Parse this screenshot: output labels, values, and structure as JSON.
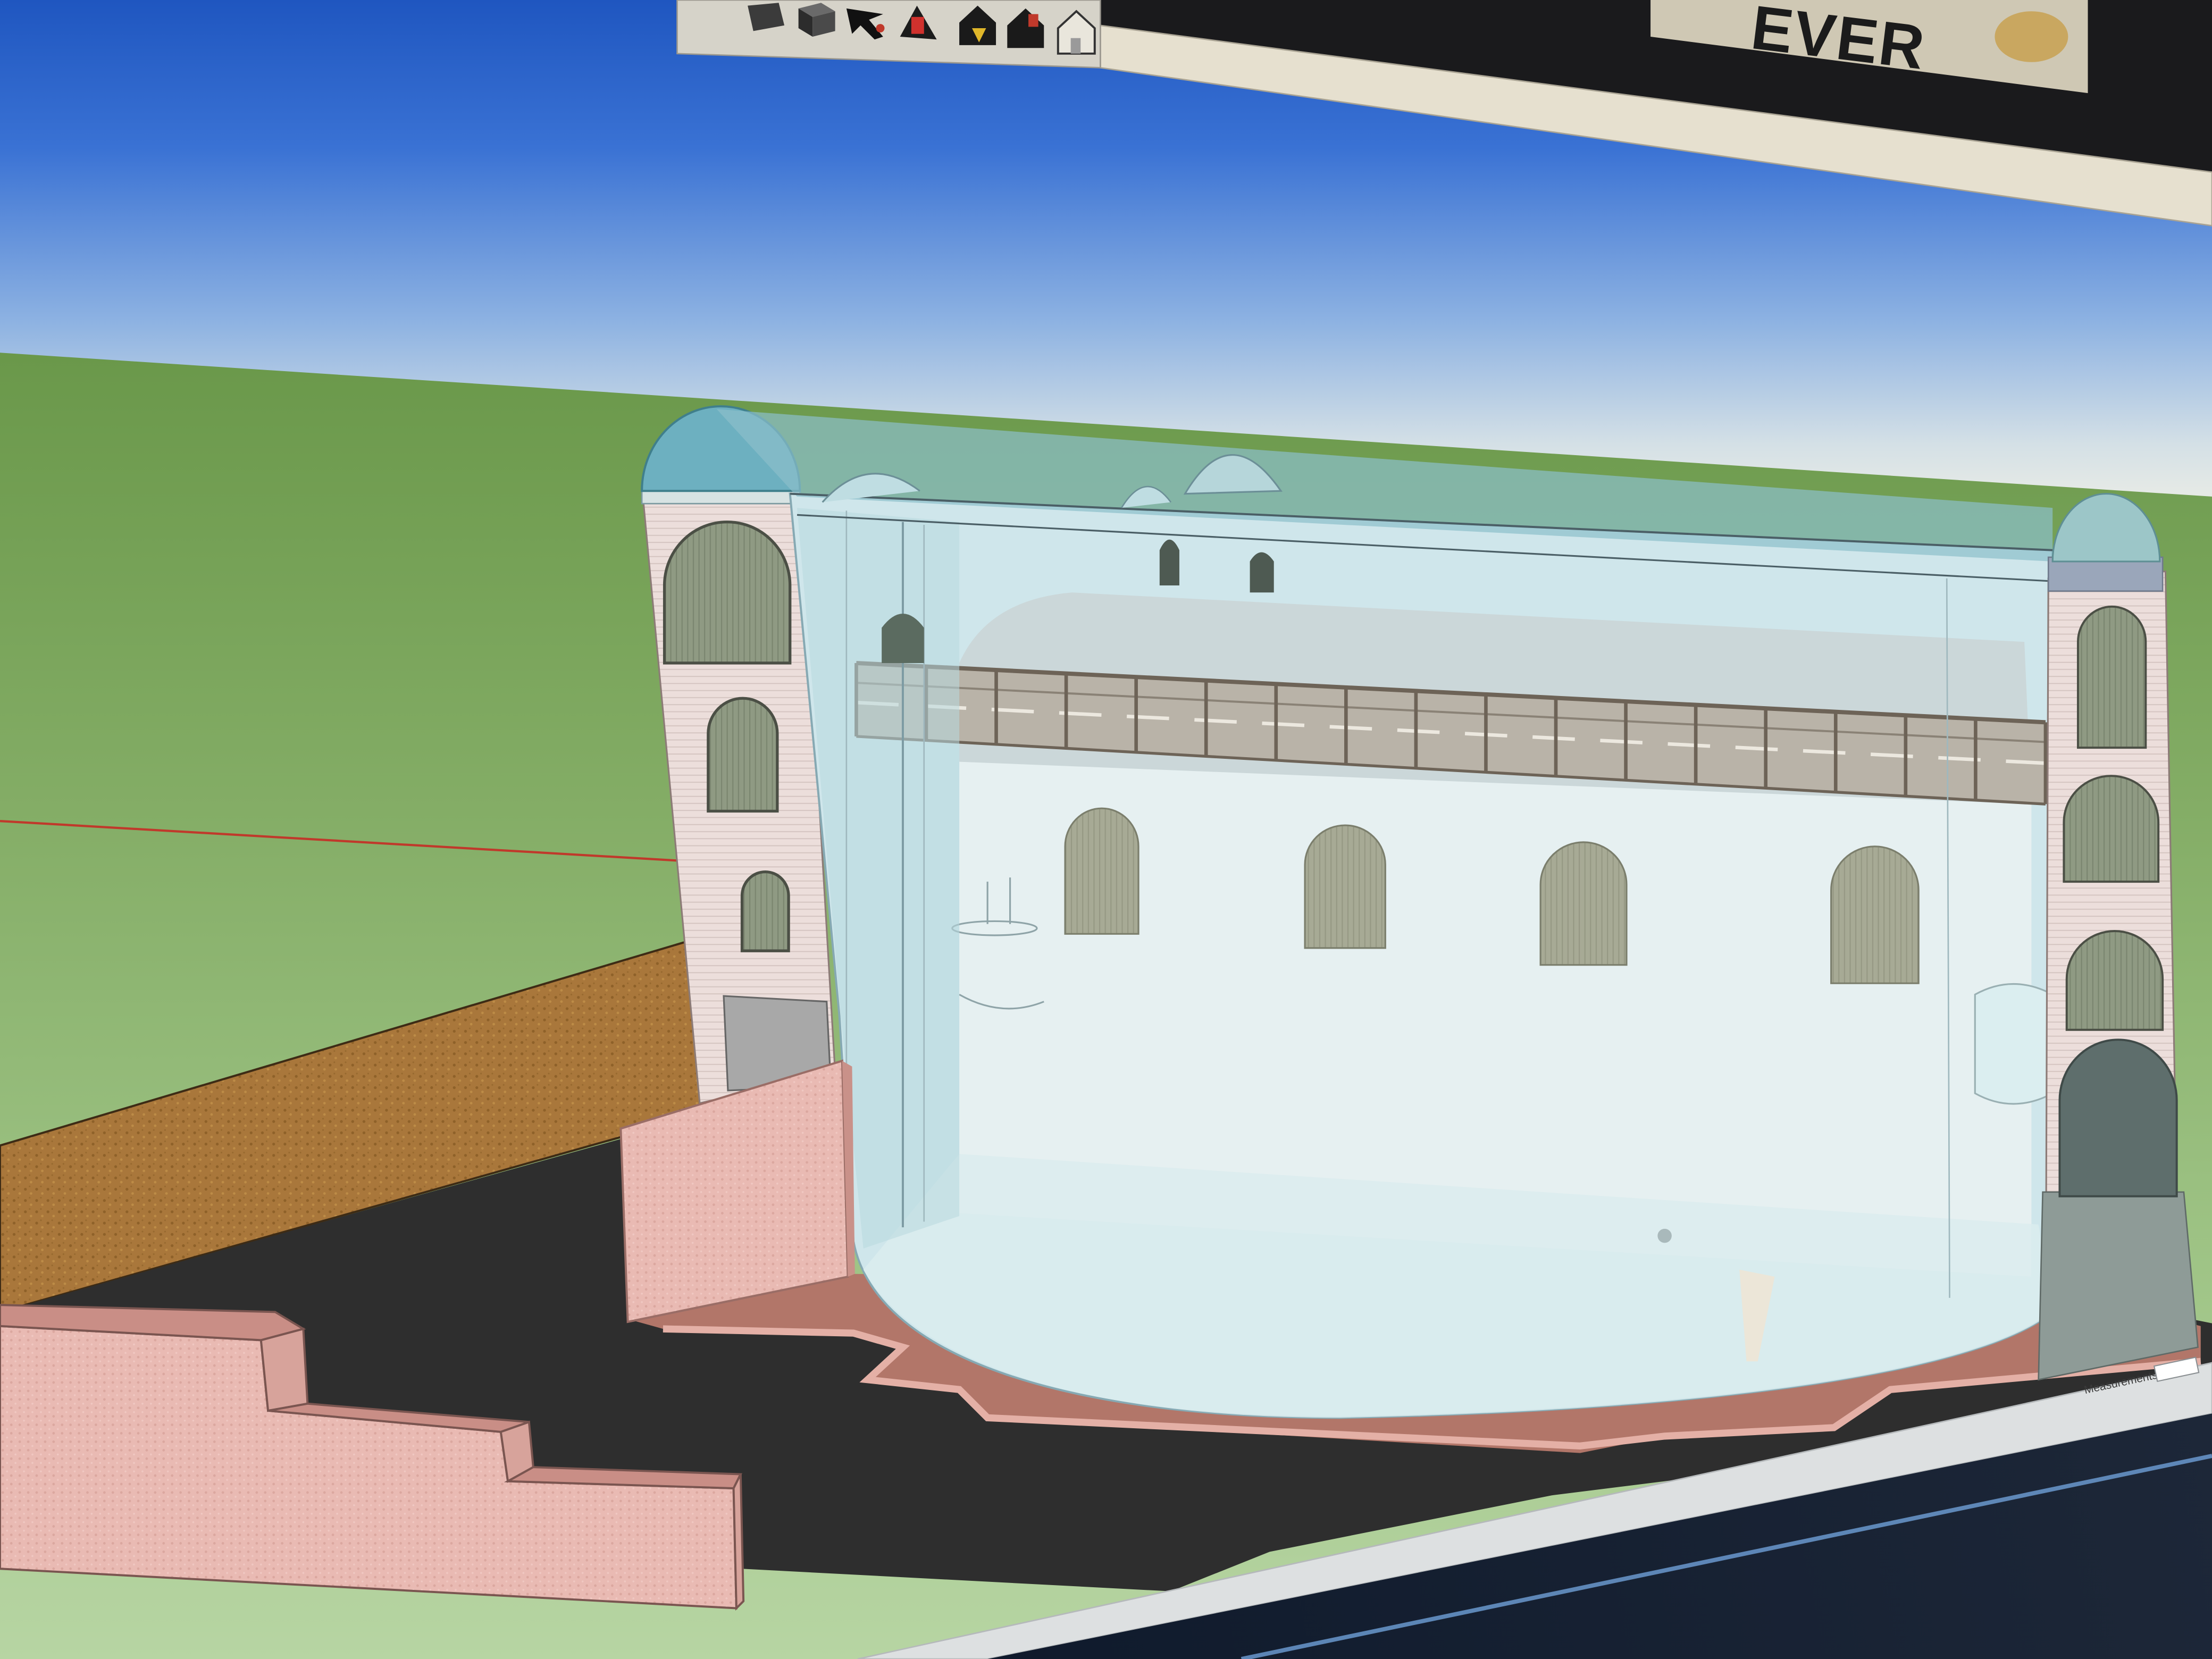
{
  "background_poster": {
    "text": "EVER"
  },
  "toolbar": {
    "icons": [
      "partial-tool-icon",
      "box-tool-icon",
      "arrow-tool-icon",
      "figure-tool-icon",
      "house-view-icon",
      "house-view-dark-icon",
      "house-outline-icon"
    ]
  },
  "status_bar": {
    "measurements_label": "Measurements"
  },
  "viewport": {
    "sky_color": "#3a72d4",
    "ground_color": "#84ad66",
    "red_axis_color": "#c0392b",
    "glass_color": "#cfe6eb",
    "wall_pink_color": "#e9bab3",
    "brick_wall_color": "#a9773b",
    "floor_color": "#2e2e2e"
  }
}
